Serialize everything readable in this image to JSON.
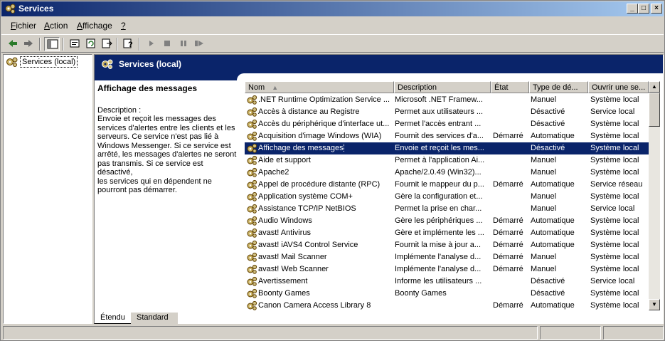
{
  "window": {
    "title": "Services"
  },
  "menu": {
    "items": [
      {
        "label": "Fichier",
        "u": "F",
        "rest": "ichier"
      },
      {
        "label": "Action",
        "u": "A",
        "rest": "ction"
      },
      {
        "label": "Affichage",
        "u": "A",
        "rest": "ffichage"
      },
      {
        "label": "?",
        "u": "?",
        "rest": ""
      }
    ]
  },
  "toolbar": {
    "icons": [
      "back-arrow-icon",
      "forward-arrow-icon",
      "show-hide-tree-icon",
      "properties-icon",
      "refresh-icon",
      "export-list-icon",
      "help-icon",
      "start-service-icon",
      "stop-service-icon",
      "pause-service-icon",
      "restart-service-icon"
    ]
  },
  "tree": {
    "root_label": "Services (local)"
  },
  "banner": {
    "title": "Services (local)"
  },
  "details": {
    "title": "Affichage des messages",
    "label": "Description :",
    "lines": [
      "Envoie et reçoit les messages des",
      "services d'alertes entre les clients et les",
      "serveurs. Ce service n'est pas lié à",
      "Windows Messenger. Si ce service est",
      "arrêté, les messages d'alertes ne seront",
      "pas transmis. Si ce service est désactivé,",
      "les services qui en dépendent ne",
      "pourront pas démarrer."
    ]
  },
  "list": {
    "columns": [
      "Nom",
      "Description",
      "État",
      "Type de dé...",
      "Ouvrir une se..."
    ],
    "rows": [
      {
        "name": ".NET Runtime Optimization Service ...",
        "description": "Microsoft .NET Framew...",
        "state": "",
        "type": "Manuel",
        "account": "Système local"
      },
      {
        "name": "Accès à distance au Registre",
        "description": "Permet aux utilisateurs ...",
        "state": "",
        "type": "Désactivé",
        "account": "Service local"
      },
      {
        "name": "Accès du périphérique d'interface ut...",
        "description": "Permet l'accès entrant ...",
        "state": "",
        "type": "Désactivé",
        "account": "Système local"
      },
      {
        "name": "Acquisition d'image Windows (WIA)",
        "description": "Fournit des services d'a...",
        "state": "Démarré",
        "type": "Automatique",
        "account": "Système local"
      },
      {
        "name": "Affichage des messages",
        "description": "Envoie et reçoit les mes...",
        "state": "",
        "type": "Désactivé",
        "account": "Système local",
        "selected": true
      },
      {
        "name": "Aide et support",
        "description": "Permet à l'application Ai...",
        "state": "",
        "type": "Manuel",
        "account": "Système local"
      },
      {
        "name": "Apache2",
        "description": "Apache/2.0.49 (Win32)...",
        "state": "",
        "type": "Manuel",
        "account": "Système local"
      },
      {
        "name": "Appel de procédure distante (RPC)",
        "description": "Fournit le mappeur du p...",
        "state": "Démarré",
        "type": "Automatique",
        "account": "Service réseau"
      },
      {
        "name": "Application système COM+",
        "description": "Gère la configuration et...",
        "state": "",
        "type": "Manuel",
        "account": "Système local"
      },
      {
        "name": "Assistance TCP/IP NetBIOS",
        "description": "Permet la prise en char...",
        "state": "",
        "type": "Manuel",
        "account": "Service local"
      },
      {
        "name": "Audio Windows",
        "description": "Gère les périphériques ...",
        "state": "Démarré",
        "type": "Automatique",
        "account": "Système local"
      },
      {
        "name": "avast! Antivirus",
        "description": "Gère et implémente les ...",
        "state": "Démarré",
        "type": "Automatique",
        "account": "Système local"
      },
      {
        "name": "avast! iAVS4 Control Service",
        "description": "Fournit la mise à jour a...",
        "state": "Démarré",
        "type": "Automatique",
        "account": "Système local"
      },
      {
        "name": "avast! Mail Scanner",
        "description": "Implémente l'analyse d...",
        "state": "Démarré",
        "type": "Manuel",
        "account": "Système local"
      },
      {
        "name": "avast! Web Scanner",
        "description": "Implémente l'analyse d...",
        "state": "Démarré",
        "type": "Manuel",
        "account": "Système local"
      },
      {
        "name": "Avertissement",
        "description": "Informe les utilisateurs ...",
        "state": "",
        "type": "Désactivé",
        "account": "Service local"
      },
      {
        "name": "Boonty Games",
        "description": "Boonty Games",
        "state": "",
        "type": "Désactivé",
        "account": "Système local"
      },
      {
        "name": "Canon Camera Access Library 8",
        "description": "",
        "state": "Démarré",
        "type": "Automatique",
        "account": "Système local"
      }
    ]
  },
  "tabs": [
    "Étendu",
    "Standard"
  ],
  "colors": {
    "selection": "#0a246a",
    "face": "#d4d0c8"
  }
}
